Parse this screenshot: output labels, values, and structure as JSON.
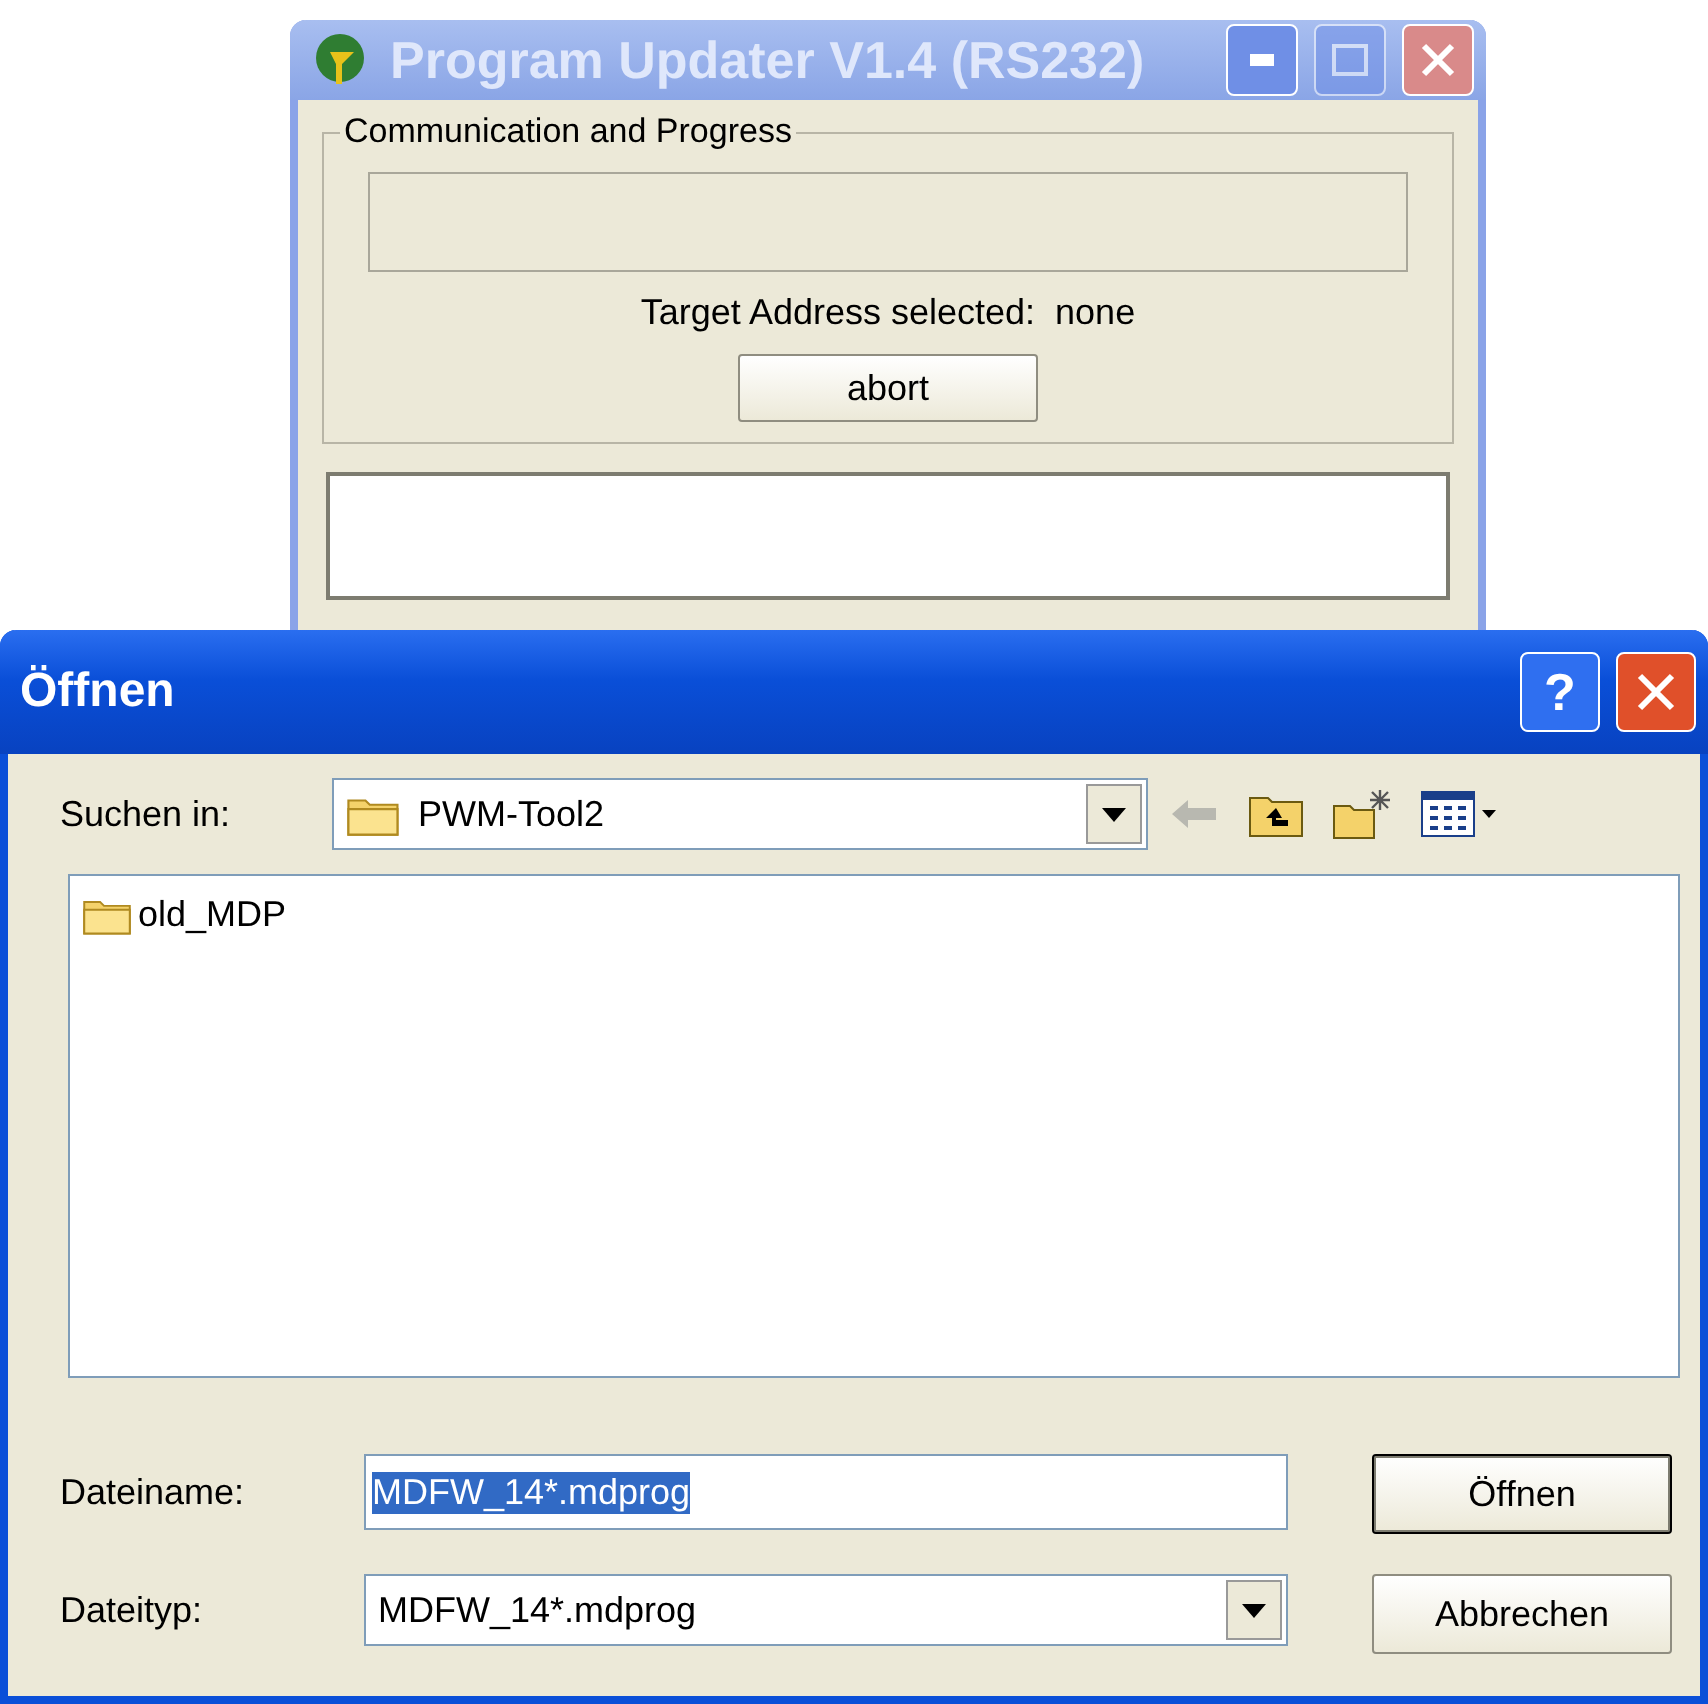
{
  "back_window": {
    "title": "Program Updater V1.4 (RS232)",
    "active": false,
    "group": {
      "label": "Communication and Progress",
      "progress": {
        "level": 0
      },
      "target_label": "Target Address selected:",
      "target_value": "none",
      "button": "abort"
    }
  },
  "dialog": {
    "title": "Öffnen",
    "active": true,
    "help_button": "?",
    "look_in": {
      "label": "Suchen in:",
      "value": "PWM-Tool2"
    },
    "files": [
      {
        "name": "old_MDP",
        "kind": "folder",
        "selected": false
      }
    ],
    "filename": {
      "label": "Dateiname:",
      "value": "MDFW_14*.mdprog",
      "text_selected": true
    },
    "filetype": {
      "label": "Dateityp:",
      "value": "MDFW_14*.mdprog"
    },
    "buttons": [
      {
        "label": "Öffnen",
        "default": true
      },
      {
        "label": "Abbrechen",
        "default": false
      }
    ]
  }
}
